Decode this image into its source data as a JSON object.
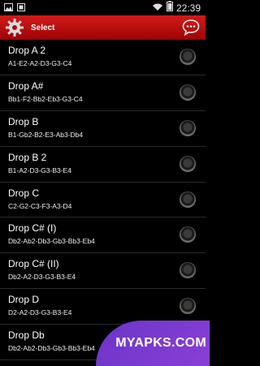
{
  "status": {
    "time": "22:39",
    "icons": [
      "image-icon",
      "screenshot-icon",
      "wifi-icon",
      "battery-icon"
    ]
  },
  "header": {
    "title": "Select",
    "left_icon": "gear-icon",
    "right_icon": "chat-bubble-icon",
    "color": "#c10f0f"
  },
  "tunings": [
    {
      "name": "Drop A 2",
      "notes": "A1-E2-A2-D3-G3-C4"
    },
    {
      "name": "Drop A#",
      "notes": "Bb1-F2-Bb2-Eb3-G3-C4"
    },
    {
      "name": "Drop B",
      "notes": "B1-Gb2-B2-E3-Ab3-Db4"
    },
    {
      "name": "Drop B 2",
      "notes": "B1-A2-D3-G3-B3-E4"
    },
    {
      "name": "Drop C",
      "notes": "C2-G2-C3-F3-A3-D4"
    },
    {
      "name": "Drop C# (I)",
      "notes": "Db2-Ab2-Db3-Gb3-Bb3-Eb4"
    },
    {
      "name": "Drop C# (II)",
      "notes": "Db2-A2-D3-G3-B3-E4"
    },
    {
      "name": "Drop D",
      "notes": "D2-A2-D3-G3-B3-E4"
    },
    {
      "name": "Drop Db",
      "notes": "Db2-Ab2-Db3-Gb3-Bb3-Eb4"
    }
  ],
  "watermark": "MYAPKS.COM"
}
